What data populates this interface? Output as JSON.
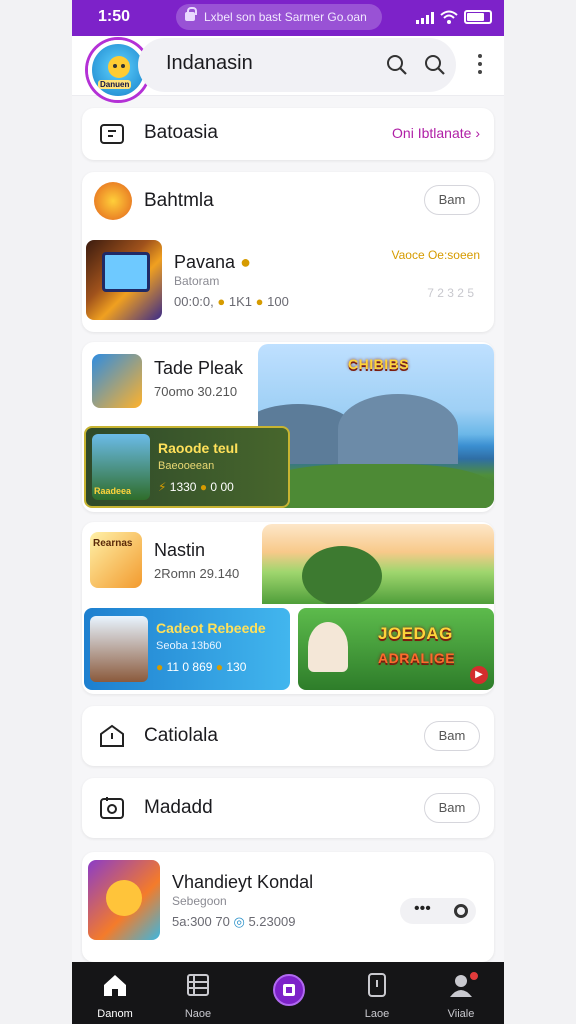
{
  "status": {
    "time": "1:50",
    "url": "Lxbel son bast Sarmer Go.oan",
    "battery": 0.75
  },
  "header": {
    "title": "Indanasin",
    "avatar_tag": "Danuen"
  },
  "promo": {
    "title": "Batoasia",
    "link": "Oni Ibtlanate"
  },
  "section_games": {
    "title": "Bahtmla",
    "button": "Bam"
  },
  "game_row": {
    "title": "Pavana",
    "subtitle": "Batoram",
    "stats": "00:0:0,",
    "stat_b": "1K1",
    "stat_c": "100",
    "right_label": "Vaoce Oe:soeen",
    "right_value": "7 2 3 2 5"
  },
  "feature_1": {
    "title": "Tade Pleak",
    "subtitle": "70omo 30.210",
    "banner": "CHIBIBS",
    "subcard": {
      "title": "Raoode teuI",
      "subtitle": "Baeooeean",
      "icon_tag": "Raadeea",
      "stat_a": "1330",
      "stat_b": "0",
      "stat_c": "00"
    }
  },
  "feature_2": {
    "title": "Nastin",
    "subtitle": "2Romn 29.140",
    "icon_tag": "Rearnas",
    "banner_line1": "JOEDAG",
    "banner_line2": "ADRALIGE",
    "subcard": {
      "title": "Cadeot Rebeede",
      "subtitle": "Seoba 13b60",
      "stat_a": "11 0 869",
      "stat_b": "130"
    }
  },
  "row_calendar": {
    "title": "Catiolala",
    "button": "Bam"
  },
  "row_media": {
    "title": "Madadd",
    "button": "Bam"
  },
  "bottom_game": {
    "title": "Vhandieyt Kondal",
    "subtitle": "Sebegoon",
    "stat_a": "5a:300 70",
    "stat_b": "5.23009"
  },
  "nav": [
    {
      "label": "Danom",
      "icon": "home-icon"
    },
    {
      "label": "Naoe",
      "icon": "list-icon"
    },
    {
      "label": "",
      "icon": "play-center-icon"
    },
    {
      "label": "Laoe",
      "icon": "tablet-icon"
    },
    {
      "label": "Viiale",
      "icon": "profile-icon"
    }
  ],
  "colors": {
    "accent": "#7d22c9",
    "link": "#b01fa6",
    "navbar": "#151517"
  }
}
